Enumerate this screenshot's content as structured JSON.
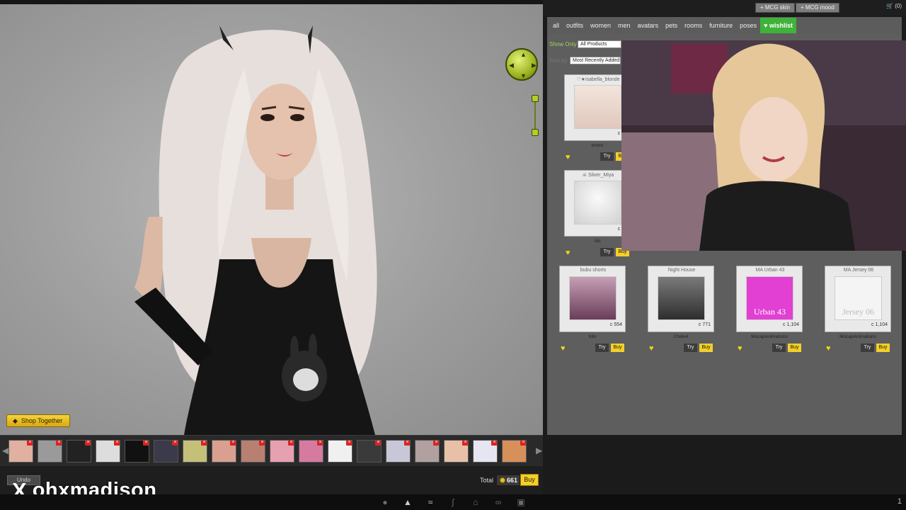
{
  "shop": {
    "topbar": {
      "mcg_skin": "+ MCG skin",
      "mcg_mood": "+ MCG mood",
      "cart_count": "(0)"
    },
    "categories": [
      "all",
      "outfits",
      "women",
      "men",
      "avatars",
      "pets",
      "rooms",
      "furniture",
      "poses",
      "wishlist"
    ],
    "active_category": "wishlist",
    "show_only_label": "Show Only",
    "show_only_value": "All Products",
    "sort_label": "Sort by",
    "sort_value": "Most Recently Added",
    "products": [
      {
        "name": "♡★isabella_blonde",
        "price": "c 7?",
        "creator": "brumi",
        "try": "Try",
        "buy": "Buy"
      },
      {
        "name": "☠ Silver_Miya",
        "price": "c 65",
        "creator": "Aki",
        "try": "Try",
        "buy": "Buy"
      },
      {
        "name": "bubu shorts",
        "price": "c 554",
        "creator": "fofo",
        "try": "Try",
        "buy": "Buy"
      },
      {
        "name": "Night House",
        "price": "c 771",
        "creator": "Chalv4",
        "try": "Try",
        "buy": "Buy"
      },
      {
        "name": "MA Urban 43",
        "price": "c 1,104",
        "creator": "MocapAnimations",
        "try": "Try",
        "buy": "Buy",
        "img_text": "Urban 43"
      },
      {
        "name": "MA Jersey 06",
        "price": "c 1,104",
        "creator": "MocapAnimations",
        "try": "Try",
        "buy": "Buy",
        "img_text": "Jersey 06"
      }
    ]
  },
  "viewport": {
    "shop_together": "Shop Together"
  },
  "cart": {
    "undo": "Undo",
    "total_label": "Total",
    "total_value": "661",
    "buy": "Buy"
  },
  "watermark": {
    "logo": "X",
    "handle": "ohxmadison"
  },
  "toolbar": {
    "right_count": "1"
  },
  "colors": {
    "accent_green": "#3fb23a",
    "buy_yellow": "#f2cf2b",
    "joystick": "#b7cc27"
  }
}
